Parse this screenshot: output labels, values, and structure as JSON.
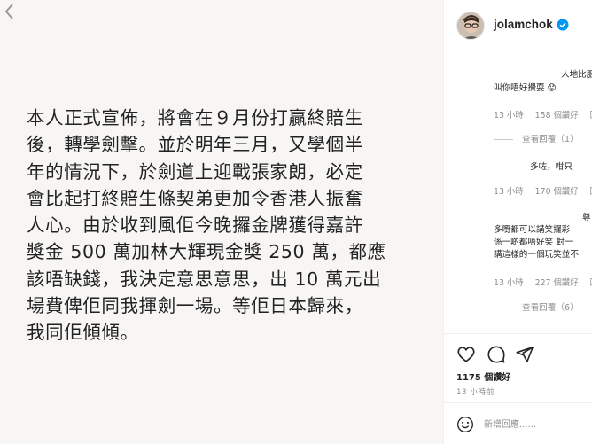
{
  "post": {
    "media_text": "本人正式宣佈，將會在９月份打贏終賠生\n後，轉學劍擊。並於明年三月，又學個半\n年的情況下，於劍道上迎戰張家朗，必定\n會比起打終賠生條契弟更加令香港人振奮\n人心。由於收到風佢今晚攞金牌獲得嘉許\n獎金 500 萬加林大輝現金獎 250 萬，都應\n該唔缺錢，我決定意思意思，出 10 萬元出\n場費俾佢同我揮劍一場。等佢日本歸來，\n我同佢傾傾。"
  },
  "header": {
    "username": "jolamchok",
    "avatar_icon": "avatar-portrait-icon",
    "verified_icon": "verified-badge-icon",
    "accent": "#0095f6"
  },
  "comments": [
    {
      "lines": [
        "人地比服",
        "叫你唔好攪耍 😟"
      ],
      "time": "13 小時",
      "likes": "158 個讚好",
      "reply": "回覆",
      "view_replies": "查看回覆（1）"
    },
    {
      "lines": [
        "多咗，咁只"
      ],
      "time": "13 小時",
      "likes": "170 個讚好",
      "reply": "回覆"
    },
    {
      "lines": [
        "尊",
        "多嘢都可以講笑攞彩",
        "係一啲都唔好笑 對一",
        "講這樣的一個玩笑並不"
      ],
      "time": "13 小時",
      "likes": "227 個讚好",
      "reply": "回覆",
      "view_replies": "查看回覆（6）"
    }
  ],
  "actions": {
    "like_icon": "heart-icon",
    "comment_icon": "comment-bubble-icon",
    "share_icon": "paper-plane-icon",
    "likes_text": "1175 個讚好",
    "posted": "13 小時前"
  },
  "comment_box": {
    "emoji_icon": "smiley-icon",
    "placeholder": "新增回應......"
  }
}
